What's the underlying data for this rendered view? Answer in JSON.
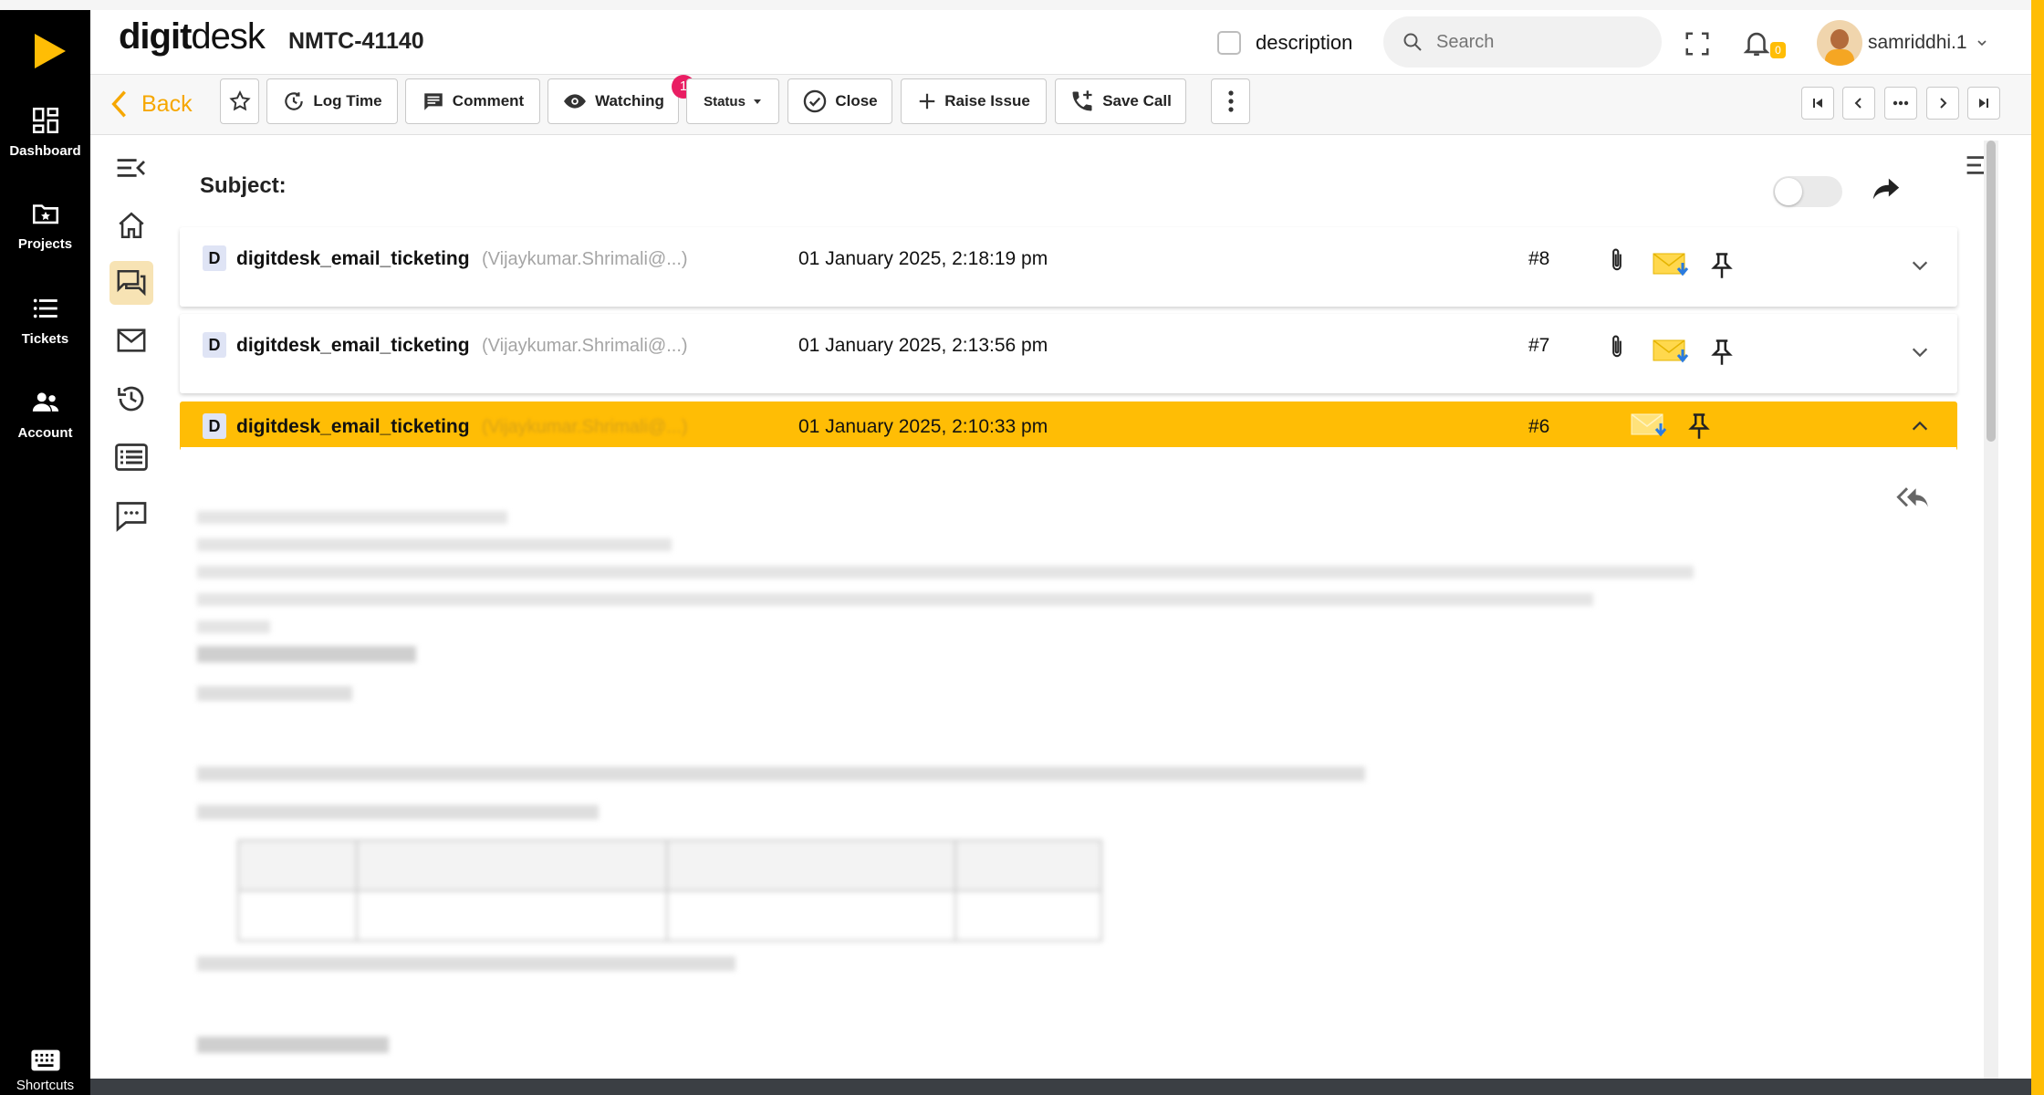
{
  "nav": {
    "items": [
      {
        "label": "Dashboard",
        "icon": "dashboard-icon"
      },
      {
        "label": "Projects",
        "icon": "folder-star-icon"
      },
      {
        "label": "Tickets",
        "icon": "list-icon"
      },
      {
        "label": "Account",
        "icon": "people-icon"
      }
    ],
    "shortcuts_label": "Shortcuts"
  },
  "header": {
    "brand_part1": "digit",
    "brand_part2": "desk",
    "ticket_id": "NMTC-41140",
    "description_label": "description",
    "search_placeholder": "Search",
    "notification_count": "0",
    "username": "samriddhi.1"
  },
  "toolbar": {
    "back_label": "Back",
    "log_time_label": "Log Time",
    "comment_label": "Comment",
    "watching_label": "Watching",
    "watching_count": "1",
    "status_label": "Status",
    "close_label": "Close",
    "raise_issue_label": "Raise Issue",
    "save_call_label": "Save Call"
  },
  "panel": {
    "subject_label": "Subject:"
  },
  "emails": [
    {
      "badge": "D",
      "sender": "digitdesk_email_ticketing",
      "sender_mail": "(Vijaykumar.Shrimali@...)",
      "date": "01 January 2025, 2:18:19 pm",
      "number": "#8"
    },
    {
      "badge": "D",
      "sender": "digitdesk_email_ticketing",
      "sender_mail": "(Vijaykumar.Shrimali@...)",
      "date": "01 January 2025, 2:13:56 pm",
      "number": "#7"
    },
    {
      "badge": "D",
      "sender": "digitdesk_email_ticketing",
      "sender_mail": "(Vijaykumar.Shrimali@...)",
      "date": "01 January 2025, 2:10:33 pm",
      "number": "#6"
    }
  ],
  "colors": {
    "accent": "#ffbd05",
    "nav_bg": "#000000",
    "badge_pink": "#e91e63"
  }
}
